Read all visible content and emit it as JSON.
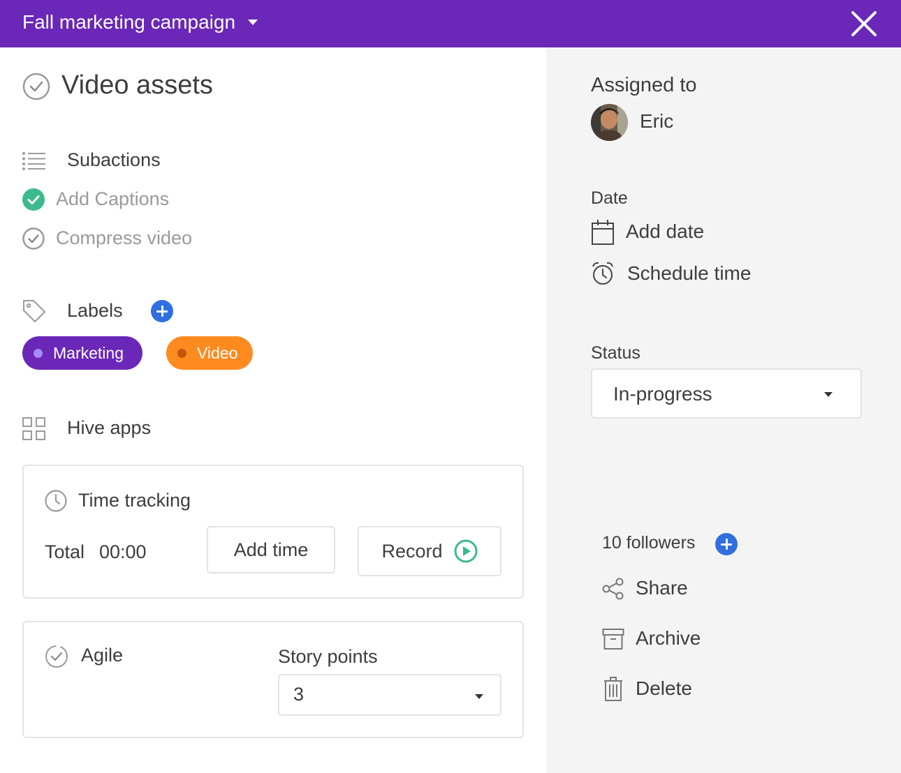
{
  "header": {
    "project_name": "Fall marketing campaign",
    "accent_color": "#6a27b8"
  },
  "task": {
    "title": "Video assets",
    "subactions": {
      "heading": "Subactions",
      "items": [
        {
          "label": "Add Captions",
          "completed": true
        },
        {
          "label": "Compress video",
          "completed": false
        }
      ]
    },
    "labels": {
      "heading": "Labels",
      "items": [
        {
          "label": "Marketing",
          "color": "#6a27b8",
          "dot_color": "#a78bfa"
        },
        {
          "label": "Video",
          "color": "#ff8a1f",
          "dot_color": "#c2570c"
        }
      ]
    },
    "hive_apps": {
      "heading": "Hive apps",
      "time_tracking": {
        "title": "Time tracking",
        "total_label": "Total",
        "total_value": "00:00",
        "add_time_label": "Add time",
        "record_label": "Record"
      },
      "agile": {
        "title": "Agile",
        "story_points_label": "Story points",
        "story_points_value": "3"
      }
    }
  },
  "sidebar": {
    "assigned_heading": "Assigned to",
    "assignee": "Eric",
    "date_heading": "Date",
    "add_date_label": "Add date",
    "schedule_time_label": "Schedule time",
    "status_heading": "Status",
    "status_value": "In-progress",
    "followers_label": "10 followers",
    "share_label": "Share",
    "archive_label": "Archive",
    "delete_label": "Delete"
  }
}
